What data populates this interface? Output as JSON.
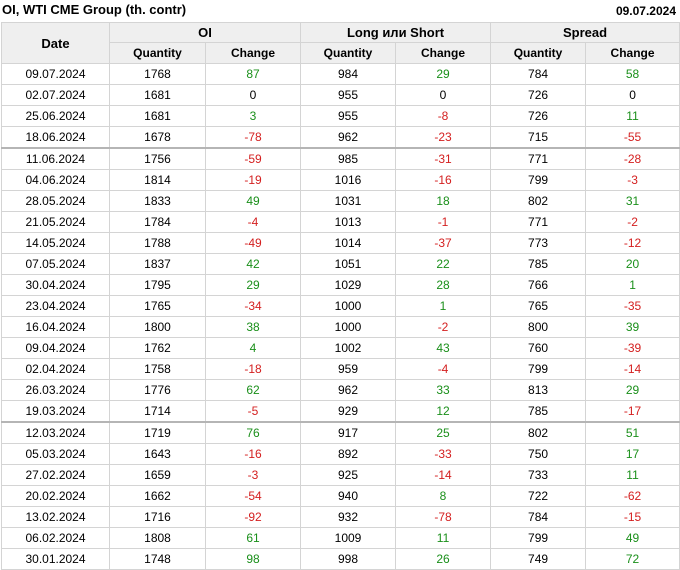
{
  "header": {
    "title": "OI, WTI CME Group (th. contr)",
    "date": "09.07.2024"
  },
  "columns": {
    "date": "Date",
    "groups": [
      "OI",
      "Long или Short",
      "Spread"
    ],
    "quantity": "Quantity",
    "change": "Change"
  },
  "rows": [
    {
      "date": "09.07.2024",
      "oi_q": "1768",
      "oi_c": "87",
      "ls_q": "984",
      "ls_c": "29",
      "sp_q": "784",
      "sp_c": "58"
    },
    {
      "date": "02.07.2024",
      "oi_q": "1681",
      "oi_c": "0",
      "ls_q": "955",
      "ls_c": "0",
      "sp_q": "726",
      "sp_c": "0"
    },
    {
      "date": "25.06.2024",
      "oi_q": "1681",
      "oi_c": "3",
      "ls_q": "955",
      "ls_c": "-8",
      "sp_q": "726",
      "sp_c": "11"
    },
    {
      "date": "18.06.2024",
      "oi_q": "1678",
      "oi_c": "-78",
      "ls_q": "962",
      "ls_c": "-23",
      "sp_q": "715",
      "sp_c": "-55"
    },
    {
      "date": "11.06.2024",
      "oi_q": "1756",
      "oi_c": "-59",
      "ls_q": "985",
      "ls_c": "-31",
      "sp_q": "771",
      "sp_c": "-28",
      "sep": true
    },
    {
      "date": "04.06.2024",
      "oi_q": "1814",
      "oi_c": "-19",
      "ls_q": "1016",
      "ls_c": "-16",
      "sp_q": "799",
      "sp_c": "-3"
    },
    {
      "date": "28.05.2024",
      "oi_q": "1833",
      "oi_c": "49",
      "ls_q": "1031",
      "ls_c": "18",
      "sp_q": "802",
      "sp_c": "31"
    },
    {
      "date": "21.05.2024",
      "oi_q": "1784",
      "oi_c": "-4",
      "ls_q": "1013",
      "ls_c": "-1",
      "sp_q": "771",
      "sp_c": "-2"
    },
    {
      "date": "14.05.2024",
      "oi_q": "1788",
      "oi_c": "-49",
      "ls_q": "1014",
      "ls_c": "-37",
      "sp_q": "773",
      "sp_c": "-12"
    },
    {
      "date": "07.05.2024",
      "oi_q": "1837",
      "oi_c": "42",
      "ls_q": "1051",
      "ls_c": "22",
      "sp_q": "785",
      "sp_c": "20"
    },
    {
      "date": "30.04.2024",
      "oi_q": "1795",
      "oi_c": "29",
      "ls_q": "1029",
      "ls_c": "28",
      "sp_q": "766",
      "sp_c": "1"
    },
    {
      "date": "23.04.2024",
      "oi_q": "1765",
      "oi_c": "-34",
      "ls_q": "1000",
      "ls_c": "1",
      "sp_q": "765",
      "sp_c": "-35"
    },
    {
      "date": "16.04.2024",
      "oi_q": "1800",
      "oi_c": "38",
      "ls_q": "1000",
      "ls_c": "-2",
      "sp_q": "800",
      "sp_c": "39"
    },
    {
      "date": "09.04.2024",
      "oi_q": "1762",
      "oi_c": "4",
      "ls_q": "1002",
      "ls_c": "43",
      "sp_q": "760",
      "sp_c": "-39"
    },
    {
      "date": "02.04.2024",
      "oi_q": "1758",
      "oi_c": "-18",
      "ls_q": "959",
      "ls_c": "-4",
      "sp_q": "799",
      "sp_c": "-14"
    },
    {
      "date": "26.03.2024",
      "oi_q": "1776",
      "oi_c": "62",
      "ls_q": "962",
      "ls_c": "33",
      "sp_q": "813",
      "sp_c": "29"
    },
    {
      "date": "19.03.2024",
      "oi_q": "1714",
      "oi_c": "-5",
      "ls_q": "929",
      "ls_c": "12",
      "sp_q": "785",
      "sp_c": "-17"
    },
    {
      "date": "12.03.2024",
      "oi_q": "1719",
      "oi_c": "76",
      "ls_q": "917",
      "ls_c": "25",
      "sp_q": "802",
      "sp_c": "51",
      "sep": true
    },
    {
      "date": "05.03.2024",
      "oi_q": "1643",
      "oi_c": "-16",
      "ls_q": "892",
      "ls_c": "-33",
      "sp_q": "750",
      "sp_c": "17"
    },
    {
      "date": "27.02.2024",
      "oi_q": "1659",
      "oi_c": "-3",
      "ls_q": "925",
      "ls_c": "-14",
      "sp_q": "733",
      "sp_c": "11"
    },
    {
      "date": "20.02.2024",
      "oi_q": "1662",
      "oi_c": "-54",
      "ls_q": "940",
      "ls_c": "8",
      "sp_q": "722",
      "sp_c": "-62"
    },
    {
      "date": "13.02.2024",
      "oi_q": "1716",
      "oi_c": "-92",
      "ls_q": "932",
      "ls_c": "-78",
      "sp_q": "784",
      "sp_c": "-15"
    },
    {
      "date": "06.02.2024",
      "oi_q": "1808",
      "oi_c": "61",
      "ls_q": "1009",
      "ls_c": "11",
      "sp_q": "799",
      "sp_c": "49"
    },
    {
      "date": "30.01.2024",
      "oi_q": "1748",
      "oi_c": "98",
      "ls_q": "998",
      "ls_c": "26",
      "sp_q": "749",
      "sp_c": "72"
    }
  ],
  "colors": {
    "positive": "#1a8f1a",
    "negative": "#d42020",
    "header_bg": "#efefef",
    "border": "#d4d4d4"
  }
}
